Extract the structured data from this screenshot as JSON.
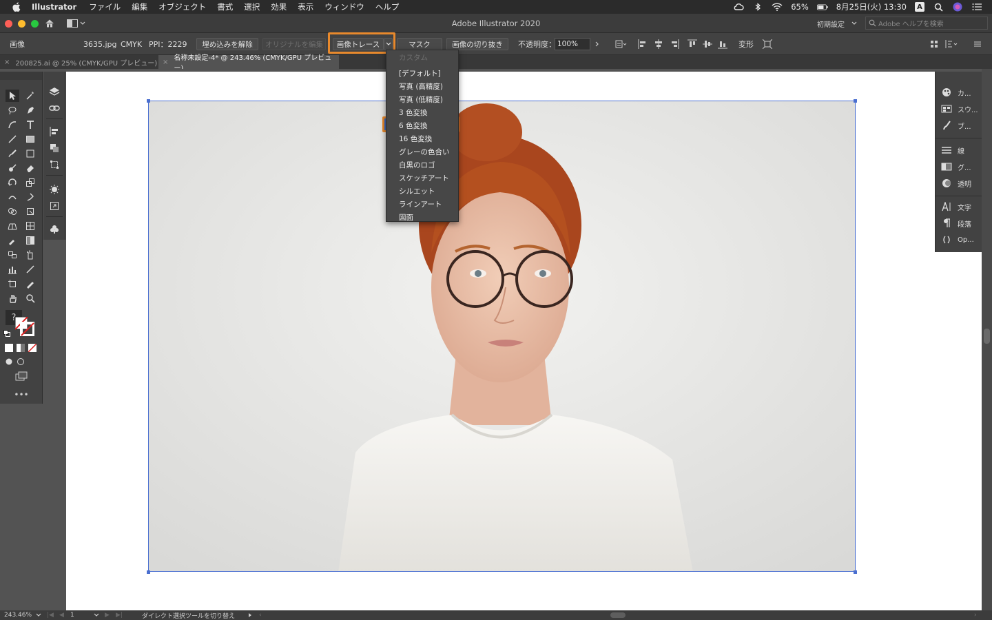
{
  "menubar": {
    "app_name": "Illustrator",
    "menus": [
      "ファイル",
      "編集",
      "オブジェクト",
      "書式",
      "選択",
      "効果",
      "表示",
      "ウィンドウ",
      "ヘルプ"
    ],
    "battery": "65%",
    "datetime": "8月25日(火) 13:30",
    "input_badge": "A"
  },
  "titlebar": {
    "title": "Adobe Illustrator 2020",
    "workspace": "初期設定",
    "help_search_placeholder": "Adobe ヘルプを検索"
  },
  "controlbar": {
    "object_type": "画像",
    "filename": "3635.jpg",
    "color_mode": "CMYK",
    "ppi": "PPI：2229",
    "unembed_button": "埋め込みを解除",
    "edit_original_button": "オリジナルを編集",
    "image_trace_button": "画像トレース",
    "mask_button": "マスク",
    "crop_button": "画像の切り抜き",
    "opacity_label": "不透明度：",
    "opacity_value": "100%",
    "transform_label": "変形"
  },
  "tabs": [
    {
      "label": "200825.ai @ 25% (CMYK/GPU プレビュー)",
      "active": false
    },
    {
      "label": "名称未設定-4* @ 243.46% (CMYK/GPU プレビュー)",
      "active": true
    }
  ],
  "dropdown": {
    "items": [
      {
        "label": "カスタム",
        "disabled": true
      },
      {
        "label": "[デフォルト]"
      },
      {
        "label": "写真 (高精度)"
      },
      {
        "label": "写真 (低精度)"
      },
      {
        "label": "3 色変換"
      },
      {
        "label": "6 色変換",
        "selected": true
      },
      {
        "label": "16 色変換"
      },
      {
        "label": "グレーの色合い"
      },
      {
        "label": "白黒のロゴ"
      },
      {
        "label": "スケッチアート"
      },
      {
        "label": "シルエット"
      },
      {
        "label": "ラインアート"
      },
      {
        "label": "図面"
      }
    ]
  },
  "right_panel": {
    "items": [
      "カ...",
      "スウ...",
      "ブ...",
      "線",
      "グ...",
      "透明",
      "文字",
      "段落",
      "Op..."
    ]
  },
  "statusbar": {
    "zoom": "243.46%",
    "page": "1",
    "tool_hint": "ダイレクト選択ツールを切り替え"
  },
  "colors": {
    "highlight": "#e8892c",
    "selection": "#4a6fd0",
    "menu_bg": "#474747"
  }
}
